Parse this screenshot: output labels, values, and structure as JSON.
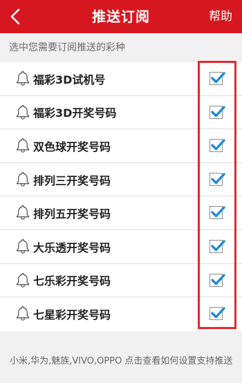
{
  "header": {
    "title": "推送订阅",
    "help_label": "帮助",
    "background_color": "#d6171f"
  },
  "subtitle": "选中您需要订阅推送的彩种",
  "items": [
    {
      "label": "福彩3D试机号",
      "checked": true,
      "icon": "bell-icon"
    },
    {
      "label": "福彩3D开奖号码",
      "checked": true,
      "icon": "bell-icon"
    },
    {
      "label": "双色球开奖号码",
      "checked": true,
      "icon": "bell-icon"
    },
    {
      "label": "排列三开奖号码",
      "checked": true,
      "icon": "bell-icon"
    },
    {
      "label": "排列五开奖号码",
      "checked": true,
      "icon": "bell-icon"
    },
    {
      "label": "大乐透开奖号码",
      "checked": true,
      "icon": "bell-icon"
    },
    {
      "label": "七乐彩开奖号码",
      "checked": true,
      "icon": "bell-icon"
    },
    {
      "label": "七星彩开奖号码",
      "checked": true,
      "icon": "bell-icon"
    }
  ],
  "footer_text": "小米,华为,魅族,VIVO,OPPO 点击查看如何设置支持推送",
  "colors": {
    "check_mark": "#1f8ad6",
    "highlight_border": "#e8262b"
  }
}
